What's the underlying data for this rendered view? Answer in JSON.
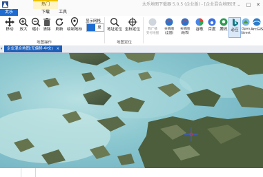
{
  "window": {
    "title": "太乐地图下载器 5.0.5 (企业版) - [企业混合地图(无偏移-中文)]",
    "context_tab": "热门"
  },
  "tabs": [
    {
      "label": "太乐"
    },
    {
      "label": "地图"
    },
    {
      "label": "下载"
    },
    {
      "label": "工具"
    }
  ],
  "map_operation": {
    "group_label": "地图操作",
    "buttons": [
      "移动",
      "放大",
      "缩小",
      "清除",
      "刷新",
      "绘制地标"
    ]
  },
  "display_grid": {
    "label": "显示网格",
    "options": [
      "格",
      "度"
    ]
  },
  "map_locate": {
    "group_label": "地图定位",
    "buttons": [
      "地址定位",
      "坐标定位"
    ]
  },
  "providers": [
    {
      "label": "我广播\n支付地图"
    },
    {
      "label": "天地图\n(全国)"
    },
    {
      "label": "天地图\n(地市)"
    },
    {
      "label": "谷歌"
    },
    {
      "label": "百度"
    },
    {
      "label": "腾讯"
    },
    {
      "label": "必应"
    },
    {
      "label": "Open\nStreet"
    },
    {
      "label": "ArcGIS"
    }
  ],
  "document_tab": "企业混合地图(无偏移-中文)"
}
